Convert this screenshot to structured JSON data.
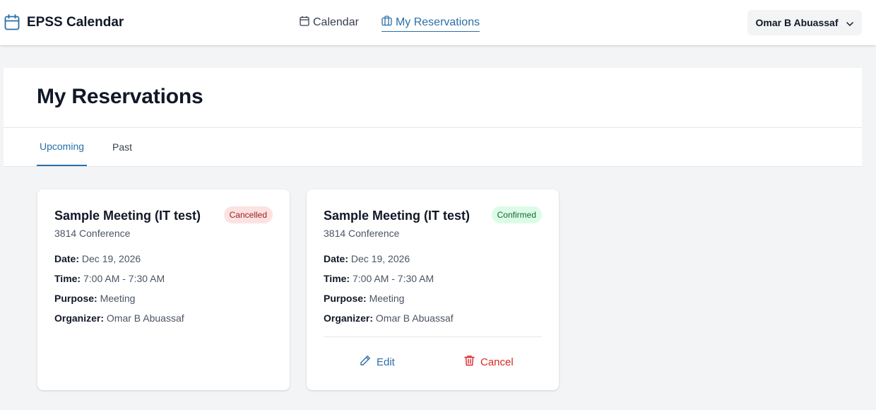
{
  "app": {
    "title": "EPSS Calendar"
  },
  "nav": {
    "calendar": "Calendar",
    "reservations": "My Reservations"
  },
  "user": {
    "name": "Omar B Abuassaf"
  },
  "page": {
    "title": "My Reservations"
  },
  "tabs": [
    {
      "label": "Upcoming",
      "active": true
    },
    {
      "label": "Past",
      "active": false
    }
  ],
  "labels": {
    "date": "Date:",
    "time": "Time:",
    "purpose": "Purpose:",
    "organizer": "Organizer:"
  },
  "reservations": [
    {
      "title": "Sample Meeting (IT test)",
      "room": "3814 Conference",
      "status": "Cancelled",
      "date": "Dec 19, 2026",
      "time": "7:00 AM - 7:30 AM",
      "purpose": "Meeting",
      "organizer": "Omar B Abuassaf"
    },
    {
      "title": "Sample Meeting (IT test)",
      "room": "3814 Conference",
      "status": "Confirmed",
      "date": "Dec 19, 2026",
      "time": "7:00 AM - 7:30 AM",
      "purpose": "Meeting",
      "organizer": "Omar B Abuassaf",
      "actions": {
        "edit": "Edit",
        "cancel": "Cancel"
      }
    }
  ],
  "colors": {
    "accent": "#2a6fa8",
    "danger": "#dc2626",
    "cancelled_badge_bg": "#fde2e2",
    "confirmed_badge_bg": "#dcfce7"
  },
  "icons": {
    "brand": "calendar-icon",
    "calendar_nav": "calendar-icon",
    "reservations_nav": "briefcase-icon",
    "user_menu": "chevron-down-icon",
    "edit": "pencil-icon",
    "cancel": "trash-icon"
  }
}
